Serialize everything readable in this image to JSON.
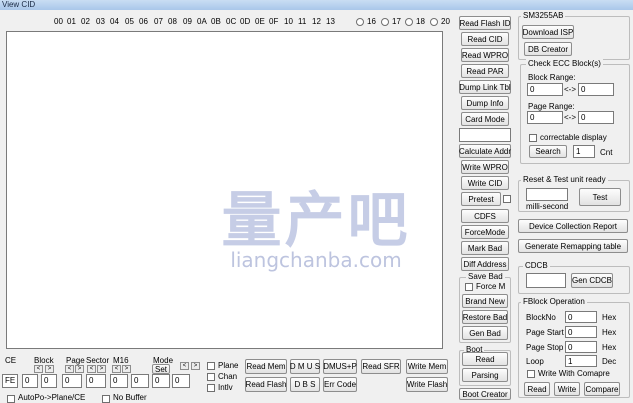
{
  "window": {
    "title": "View CID"
  },
  "hex_header": {
    "columns": [
      "00",
      "01",
      "02",
      "03",
      "04",
      "05",
      "06",
      "07",
      "08",
      "09",
      "0A",
      "0B",
      "0C",
      "0D",
      "0E",
      "0F",
      "10",
      "11",
      "12",
      "13"
    ],
    "radio_options": [
      "16",
      "17",
      "18",
      "20"
    ]
  },
  "watermark": {
    "cn_text": "量产吧",
    "site": "liangchanba.com"
  },
  "mid_buttons": {
    "read_flash_id": "Read Flash ID",
    "read_cid": "Read CID",
    "read_wpro": "Read WPRO",
    "read_par": "Read PAR",
    "dump_link_tbl": "Dump Link Tbl",
    "dump_info": "Dump Info",
    "card_mode": "Card Mode",
    "calculate_addr": "Calculate Addr",
    "write_wpro": "Write WPRO",
    "write_cid": "Write CID",
    "pretest": "Pretest",
    "cdfs": "CDFS",
    "force_mode": "ForceMode",
    "mark_bad": "Mark Bad",
    "diff_address": "Diff Address",
    "brand_new": "Brand New",
    "restore_bad": "Restore Bad",
    "gen_bad": "Gen Bad",
    "read": "Read",
    "parsing": "Parsing",
    "boot_creator": "Boot Creator"
  },
  "save_bad": {
    "title": "Save Bad",
    "force_m": "Force M"
  },
  "boot": {
    "title": "Boot"
  },
  "sm3255ab": {
    "title": "SM3255AB",
    "download_isp": "Download ISP",
    "db_creator": "DB Creator"
  },
  "ecc": {
    "title": "Check ECC Block(s)",
    "block_range_label": "Block Range:",
    "block_from": "0",
    "block_to": "0",
    "page_range_label": "Page Range:",
    "page_from": "0",
    "page_to": "0",
    "range_sep": "<->",
    "correctable_display": "correctable display",
    "search": "Search",
    "cnt_value": "1",
    "cnt_label": "Cnt"
  },
  "reset_test": {
    "title": "Reset & Test unit ready",
    "milli_second": "milli-second",
    "test": "Test"
  },
  "right_buttons": {
    "device_collection_report": "Device Collection Report",
    "generate_remapping_table": "Generate Remapping table"
  },
  "cdcb": {
    "title": "CDCB",
    "gen_cdcb": "Gen CDCB"
  },
  "fblock": {
    "title": "FBlock Operation",
    "block_no": "BlockNo",
    "block_no_value": "0",
    "page_start": "Page Start",
    "page_start_value": "0",
    "page_stop": "Page Stop",
    "page_stop_value": "0",
    "loop": "Loop",
    "loop_value": "1",
    "hex": "Hex",
    "dec": "Dec",
    "write_with_compare": "Write With Comapre",
    "read": "Read",
    "write": "Write",
    "compare": "Compare"
  },
  "bottom": {
    "ce_label": "CE",
    "ce_value": "FE",
    "block_label": "Block",
    "block_value": "0",
    "page_label": "Page",
    "page_value": "0",
    "sector_label": "Sector",
    "sector_value": "0",
    "m16_label": "M16",
    "m16_value": "0",
    "mode_label": "Mode",
    "set": "Set",
    "mode_value": "0",
    "extra_value": "0",
    "plane": "Plane",
    "chan": "Chan",
    "intlv": "Intlv",
    "read_mem": "Read Mem",
    "read_flash": "Read Flash",
    "dmus": "D M U S",
    "dbs": "D B S",
    "dmus_plus_p": "DMUS+P",
    "err_code": "Err Code",
    "read_sfr": "Read SFR",
    "write_mem": "Write Mem",
    "write_flash": "Write Flash",
    "auto_po": "AutoPo->Plane/CE",
    "no_buffer": "No Buffer",
    "left_arrow": "<",
    "right_arrow": ">"
  }
}
